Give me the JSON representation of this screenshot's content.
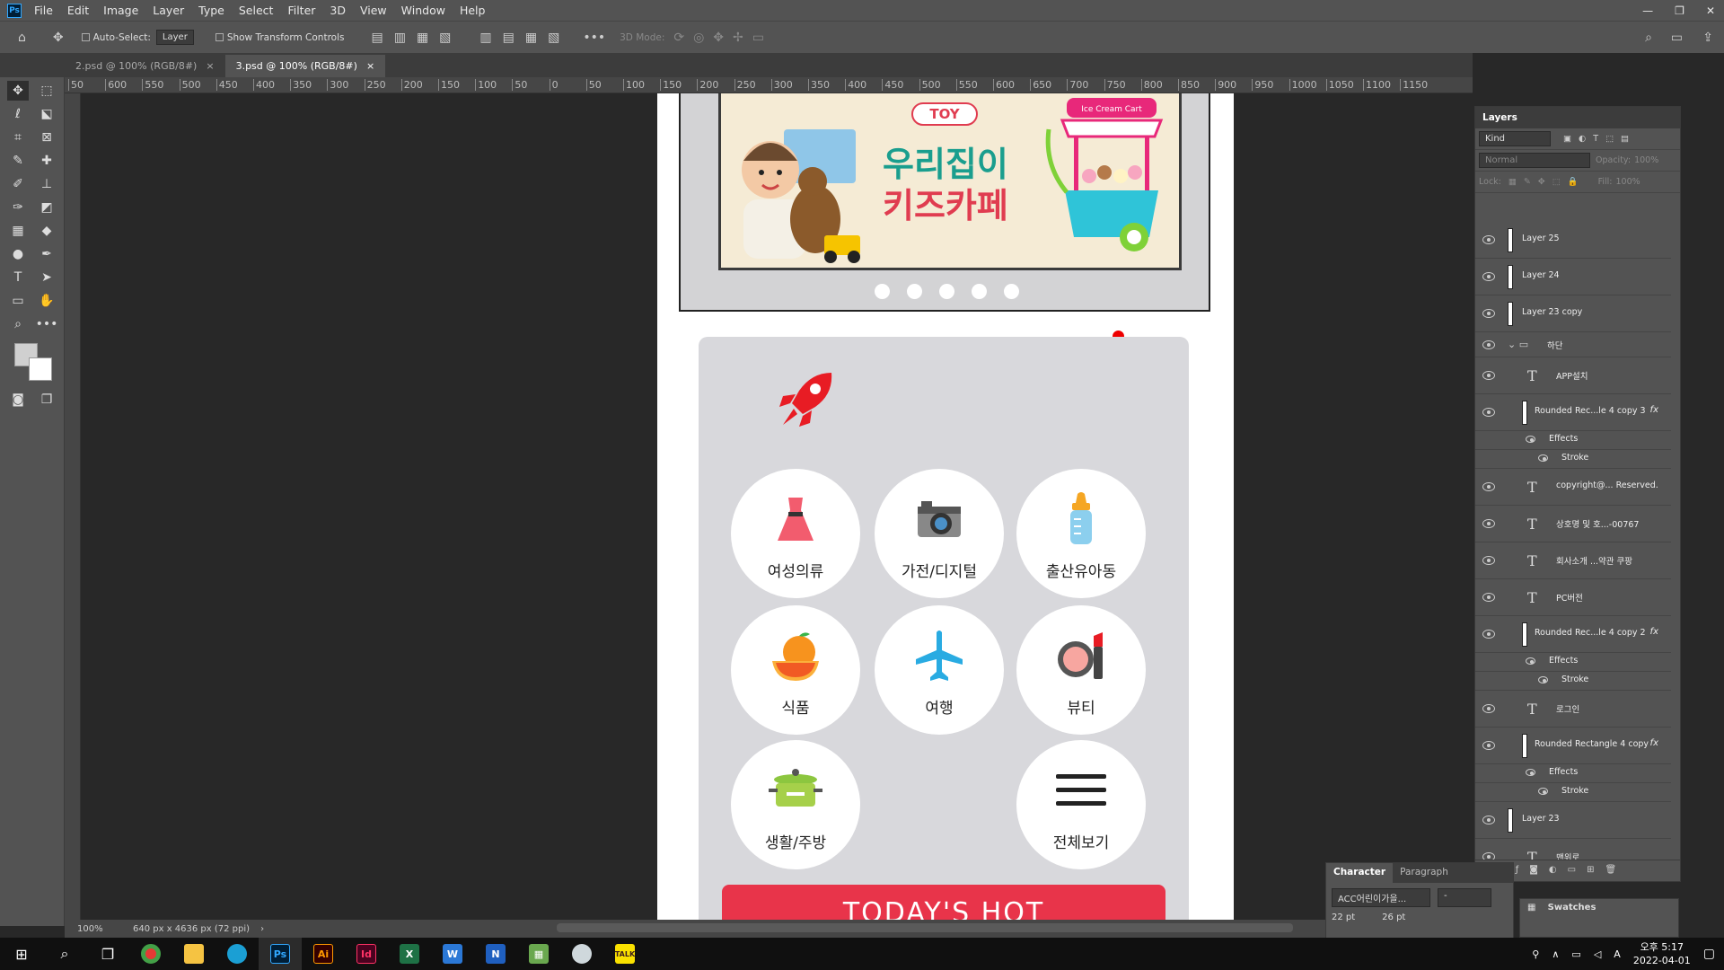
{
  "app": {
    "logo": "Ps",
    "menu": [
      "File",
      "Edit",
      "Image",
      "Layer",
      "Type",
      "Select",
      "Filter",
      "3D",
      "View",
      "Window",
      "Help"
    ]
  },
  "options_bar": {
    "auto_select_label": "Auto-Select:",
    "auto_select_value": "Layer",
    "transform_label": "Show Transform Controls",
    "mode_3d": "3D Mode:"
  },
  "tabs": [
    {
      "label": "2.psd @ 100% (RGB/8#)"
    },
    {
      "label": "3.psd @ 100% (RGB/8#)"
    }
  ],
  "ruler_ticks": [
    "50",
    "600",
    "550",
    "500",
    "450",
    "400",
    "350",
    "300",
    "250",
    "200",
    "150",
    "100",
    "50",
    "0",
    "50",
    "100",
    "150",
    "200",
    "250",
    "300",
    "350",
    "400",
    "450",
    "500",
    "550",
    "600",
    "650",
    "700",
    "750",
    "800",
    "850",
    "900",
    "950",
    "1000",
    "1050",
    "1100",
    "1150"
  ],
  "artboard": {
    "banner": {
      "badge": "TOY",
      "line1": "우리집이",
      "line2": "키즈카페",
      "cart_sign": "Ice Cream Cart"
    },
    "slider_dot_count": 5,
    "categories": [
      {
        "label": "여성의류",
        "icon": "dress-icon"
      },
      {
        "label": "가전/디지털",
        "icon": "camera-icon"
      },
      {
        "label": "출산유아동",
        "icon": "baby-bottle-icon"
      },
      {
        "label": "식품",
        "icon": "orange-icon"
      },
      {
        "label": "여행",
        "icon": "airplane-icon"
      },
      {
        "label": "뷰티",
        "icon": "makeup-icon"
      },
      {
        "label": "생활/주방",
        "icon": "pot-icon"
      },
      {
        "label": "전체보기",
        "icon": "menu-lines-icon"
      }
    ],
    "hot_button": "TODAY'S HOT"
  },
  "statusbar": {
    "zoom": "100%",
    "doc_size": "640 px x 4636 px (72 ppi)"
  },
  "layers_panel": {
    "title": "Layers",
    "filter_kind": "Kind",
    "blend": "Normal",
    "opacity_label": "Opacity:",
    "opacity": "100%",
    "lock_label": "Lock:",
    "fill_label": "Fill:",
    "fill": "100%",
    "rows": [
      {
        "name": "Layer 25",
        "type": "pixel"
      },
      {
        "name": "Layer 24",
        "type": "pixel"
      },
      {
        "name": "Layer 23 copy",
        "type": "pixel"
      },
      {
        "name": "하단",
        "type": "group"
      },
      {
        "name": "APP설치",
        "type": "text"
      },
      {
        "name": "Rounded Rec...le 4 copy 3",
        "type": "shape",
        "fx": "fx"
      },
      {
        "name": "Effects",
        "type": "effects"
      },
      {
        "name": "Stroke",
        "type": "stroke"
      },
      {
        "name": "copyright@... Reserved.",
        "type": "text"
      },
      {
        "name": "상호명 및 호...-00767",
        "type": "text"
      },
      {
        "name": "회사소개 ...약관 쿠팡",
        "type": "text"
      },
      {
        "name": "PC버전",
        "type": "text"
      },
      {
        "name": "Rounded Rec...le 4 copy 2",
        "type": "shape",
        "fx": "fx"
      },
      {
        "name": "Effects",
        "type": "effects"
      },
      {
        "name": "Stroke",
        "type": "stroke"
      },
      {
        "name": "로그인",
        "type": "text"
      },
      {
        "name": "Rounded Rectangle 4 copy",
        "type": "shape",
        "fx": "fx"
      },
      {
        "name": "Effects",
        "type": "effects"
      },
      {
        "name": "Stroke",
        "type": "stroke"
      },
      {
        "name": "Layer 23",
        "type": "pixel"
      },
      {
        "name": "맨위로",
        "type": "text"
      }
    ]
  },
  "character_panel": {
    "tab1": "Character",
    "tab2": "Paragraph",
    "font": "ACC어린이가을...",
    "style": "-",
    "size": "22 pt",
    "leading": "26 pt"
  },
  "swatches_panel": {
    "title": "Swatches"
  },
  "taskbar": {
    "time": "오후 5:17",
    "date": "2022-04-01",
    "ime": "A"
  }
}
